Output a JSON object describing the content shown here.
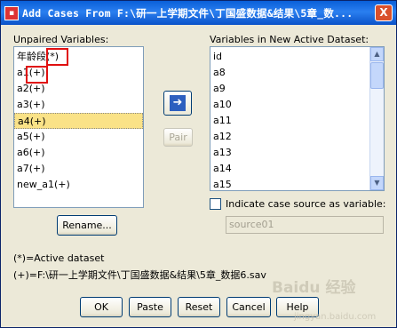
{
  "window": {
    "title": "Add Cases From F:\\研一上学期文件\\丁国盛数据&结果\\5章_数...",
    "close_label": "X"
  },
  "unpaired": {
    "label": "Unpaired Variables:",
    "items": [
      "年龄段(*)",
      "a1(+)",
      "a2(+)",
      "a3(+)",
      "a4(+)",
      "a5(+)",
      "a6(+)",
      "a7(+)",
      "new_a1(+)"
    ],
    "selected_index": 4
  },
  "new_dataset": {
    "label": "Variables in New Active Dataset:",
    "items": [
      "id",
      "a8",
      "a9",
      "a10",
      "a11",
      "a12",
      "a13",
      "a14",
      "a15"
    ]
  },
  "buttons": {
    "pair": "Pair",
    "rename": "Rename...",
    "ok": "OK",
    "paste": "Paste",
    "reset": "Reset",
    "cancel": "Cancel",
    "help": "Help"
  },
  "indicate": {
    "label": "Indicate case source as variable:",
    "value": "source01"
  },
  "legend": {
    "active": "(*)=Active dataset",
    "file": "(+)=F:\\研一上学期文件\\丁国盛数据&结果\\5章_数据6.sav"
  },
  "watermark": {
    "text": "Baidu 经验",
    "url": "jingyan.baidu.com"
  }
}
